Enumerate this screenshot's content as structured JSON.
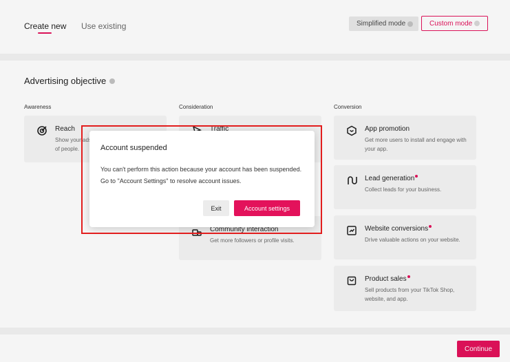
{
  "tabs": {
    "create_new": "Create new",
    "use_existing": "Use existing"
  },
  "modes": {
    "simplified": "Simplified mode",
    "custom": "Custom mode"
  },
  "objective": {
    "title": "Advertising objective",
    "columns": {
      "awareness": "Awareness",
      "consideration": "Consideration",
      "conversion": "Conversion"
    },
    "reach": {
      "title": "Reach",
      "desc_line1": "Show your ads",
      "desc_line2": "of people."
    },
    "traffic": {
      "title": "Traffic"
    },
    "community": {
      "title": "Community interaction",
      "desc": "Get more followers or profile visits."
    },
    "app_promotion": {
      "title": "App promotion",
      "desc": "Get more users to install and engage with your app."
    },
    "lead_generation": {
      "title": "Lead generation",
      "desc": "Collect leads for your business."
    },
    "website_conversions": {
      "title": "Website conversions",
      "desc": "Drive valuable actions on your website."
    },
    "product_sales": {
      "title": "Product sales",
      "desc": "Sell products from your TikTok Shop, website, and app."
    }
  },
  "footer": {
    "continue": "Continue"
  },
  "modal": {
    "title": "Account suspended",
    "body": "You can't perform this action because your account has been suspended. Go to \"Account Settings\" to resolve account issues.",
    "exit": "Exit",
    "settings": "Account settings"
  },
  "colors": {
    "accent": "#e3125b",
    "highlight": "#e21d1d"
  }
}
